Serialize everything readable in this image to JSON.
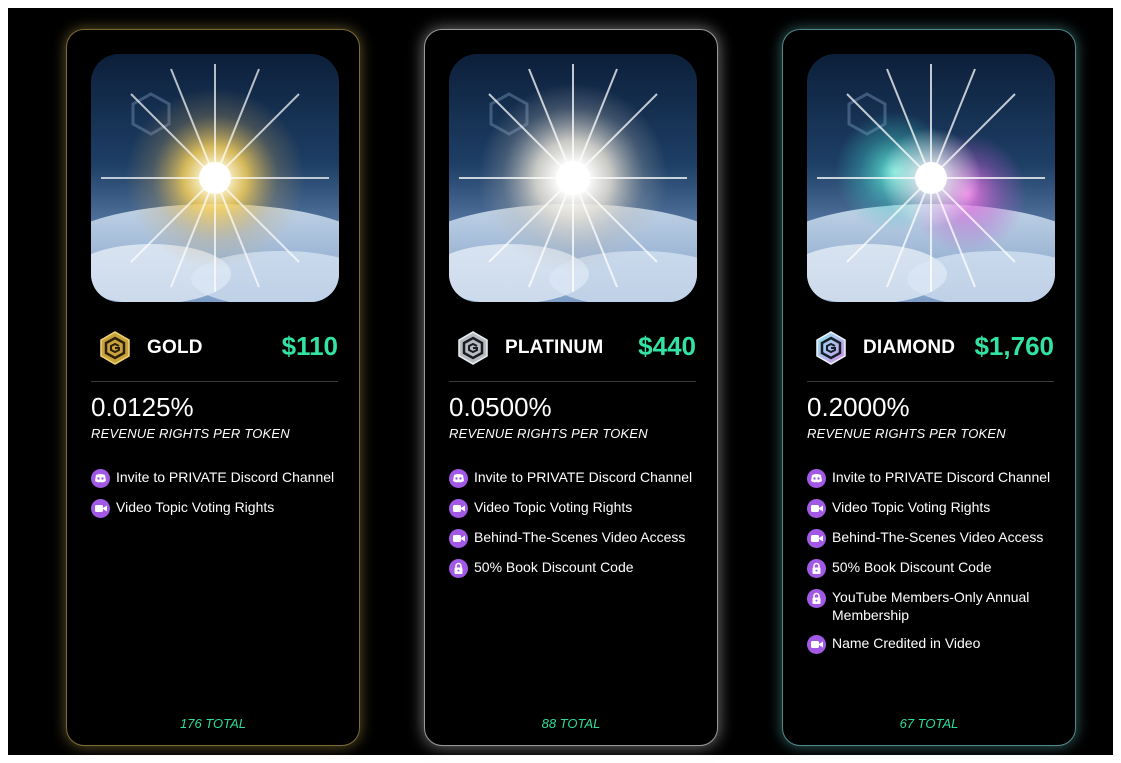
{
  "cards": [
    {
      "tier": "GOLD",
      "price": "$110",
      "percentage": "0.0125%",
      "rights_label": "REVENUE RIGHTS PER TOKEN",
      "total": "176 TOTAL",
      "accent": "#e8c25a",
      "perks": [
        {
          "label": "Invite to PRIVATE Discord Channel",
          "icon": "discord-icon"
        },
        {
          "label": "Video Topic Voting Rights",
          "icon": "video-camera-icon"
        }
      ]
    },
    {
      "tier": "PLATINUM",
      "price": "$440",
      "percentage": "0.0500%",
      "rights_label": "REVENUE RIGHTS PER TOKEN",
      "total": "88 TOTAL",
      "accent": "#dcdcdc",
      "perks": [
        {
          "label": "Invite to PRIVATE Discord Channel",
          "icon": "discord-icon"
        },
        {
          "label": "Video Topic Voting Rights",
          "icon": "video-camera-icon"
        },
        {
          "label": "Behind-The-Scenes Video Access",
          "icon": "video-camera-icon"
        },
        {
          "label": "50% Book Discount Code",
          "icon": "lock-icon"
        }
      ]
    },
    {
      "tier": "DIAMOND",
      "price": "$1,760",
      "percentage": "0.2000%",
      "rights_label": "REVENUE RIGHTS PER TOKEN",
      "total": "67 TOTAL",
      "accent": "#7fe3e0",
      "perks": [
        {
          "label": "Invite to PRIVATE Discord Channel",
          "icon": "discord-icon"
        },
        {
          "label": "Video Topic Voting Rights",
          "icon": "video-camera-icon"
        },
        {
          "label": "Behind-The-Scenes Video Access",
          "icon": "video-camera-icon"
        },
        {
          "label": "50% Book Discount Code",
          "icon": "lock-icon"
        },
        {
          "label": "YouTube Members-Only Annual Membership",
          "icon": "lock-icon"
        },
        {
          "label": "Name Credited in Video",
          "icon": "video-camera-icon"
        }
      ]
    }
  ],
  "colors": {
    "price": "#33e3a3",
    "total": "#2ddc9b",
    "perk_icon_bg": "#a259e6",
    "background": "#000000"
  }
}
